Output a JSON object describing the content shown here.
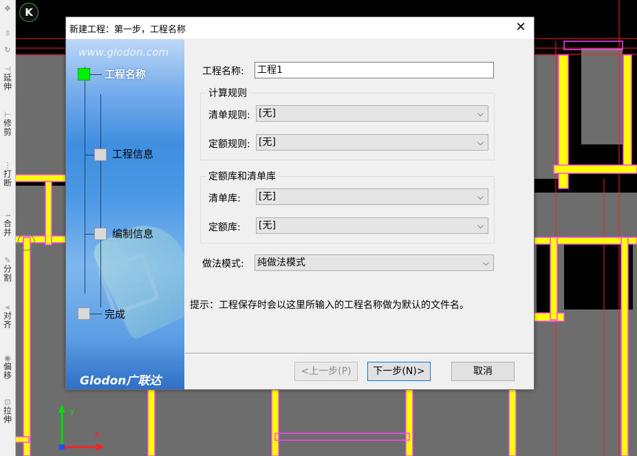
{
  "cad": {
    "marker_k": "K",
    "axis_y": "Y",
    "axis_x": "X",
    "toolbar": [
      {
        "name": "extend",
        "label": "延伸"
      },
      {
        "name": "trim",
        "label": "修剪"
      },
      {
        "name": "break",
        "label": "打断"
      },
      {
        "name": "merge",
        "label": "合并"
      },
      {
        "name": "split",
        "label": "分割"
      },
      {
        "name": "align",
        "label": "对齐"
      },
      {
        "name": "offset",
        "label": "偏移"
      },
      {
        "name": "stretch",
        "label": "拉伸"
      }
    ],
    "colors": {
      "wall": "#ffff00",
      "outline": "#ff44ff",
      "redline": "#ff2020",
      "floor": "#6d6d6d",
      "background": "#000000"
    }
  },
  "dialog": {
    "title": "新建工程：第一步，工程名称",
    "close_icon": "close-icon",
    "side": {
      "url": "www.glodon.com",
      "logo": "Glodon广联达",
      "steps": [
        {
          "label": "工程名称",
          "active": true
        },
        {
          "label": "工程信息",
          "active": false
        },
        {
          "label": "编制信息",
          "active": false
        },
        {
          "label": "完成",
          "active": false
        }
      ]
    },
    "form": {
      "project_name_label": "工程名称:",
      "project_name_value": "工程1",
      "calc_rules_title": "计算规则",
      "list_rule_label": "清单规则:",
      "list_rule_value": "[无]",
      "quota_rule_label": "定额规则:",
      "quota_rule_value": "[无]",
      "libs_title": "定额库和清单库",
      "list_lib_label": "清单库:",
      "list_lib_value": "[无]",
      "quota_lib_label": "定额库:",
      "quota_lib_value": "[无]",
      "method_mode_label": "做法模式:",
      "method_mode_value": "纯做法模式",
      "hint": "提示：工程保存时会以这里所输入的工程名称做为默认的文件名。"
    },
    "buttons": {
      "prev": "<上一步(P)",
      "next": "下一步(N)>",
      "cancel": "取消"
    }
  }
}
